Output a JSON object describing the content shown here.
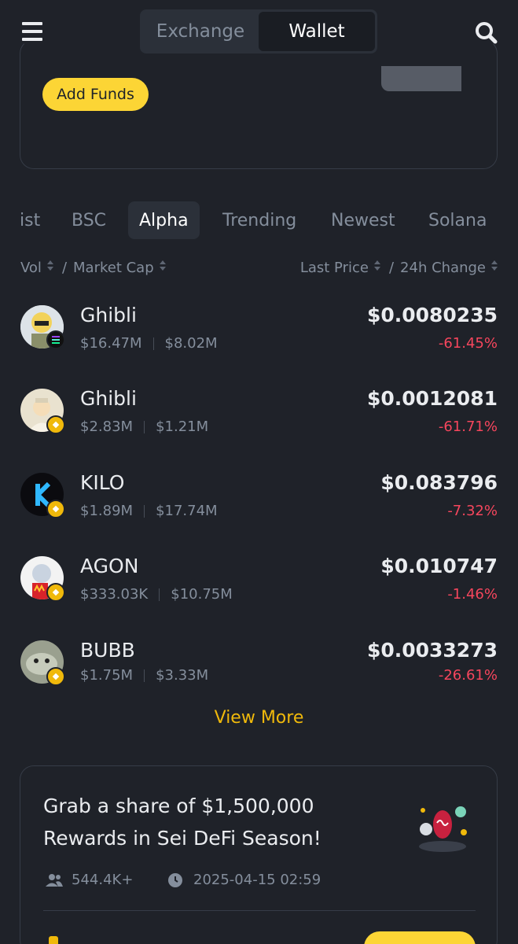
{
  "header": {
    "tabs": [
      {
        "label": "Exchange",
        "active": false
      },
      {
        "label": "Wallet",
        "active": true
      }
    ]
  },
  "funds": {
    "add_funds_label": "Add Funds"
  },
  "market_tabs": [
    {
      "label": "ist",
      "active": false
    },
    {
      "label": "BSC",
      "active": false
    },
    {
      "label": "Alpha",
      "active": true
    },
    {
      "label": "Trending",
      "active": false
    },
    {
      "label": "Newest",
      "active": false
    },
    {
      "label": "Solana",
      "active": false
    }
  ],
  "columns": {
    "vol": "Vol",
    "slash": "/",
    "market_cap": "Market Cap",
    "last_price": "Last Price",
    "change": "24h Change"
  },
  "tokens": [
    {
      "name": "Ghibli",
      "vol": "$16.47M",
      "mcap": "$8.02M",
      "price": "$0.0080235",
      "change": "-61.45%",
      "chain": "sol"
    },
    {
      "name": "Ghibli",
      "vol": "$2.83M",
      "mcap": "$1.21M",
      "price": "$0.0012081",
      "change": "-61.71%",
      "chain": "bsc"
    },
    {
      "name": "KILO",
      "vol": "$1.89M",
      "mcap": "$17.74M",
      "price": "$0.083796",
      "change": "-7.32%",
      "chain": "bsc"
    },
    {
      "name": "AGON",
      "vol": "$333.03K",
      "mcap": "$10.75M",
      "price": "$0.010747",
      "change": "-1.46%",
      "chain": "bsc"
    },
    {
      "name": "BUBB",
      "vol": "$1.75M",
      "mcap": "$3.33M",
      "price": "$0.0033273",
      "change": "-26.61%",
      "chain": "bsc"
    }
  ],
  "view_more_label": "View More",
  "promo": {
    "title": "Grab a share of $1,500,000 Rewards in Sei DeFi Season!",
    "participants": "544.4K+",
    "date": "2025-04-15 02:59"
  },
  "colors": {
    "background": "#1f2229",
    "accent": "#fcd535",
    "negative": "#f6465d",
    "muted": "#848e9c"
  }
}
